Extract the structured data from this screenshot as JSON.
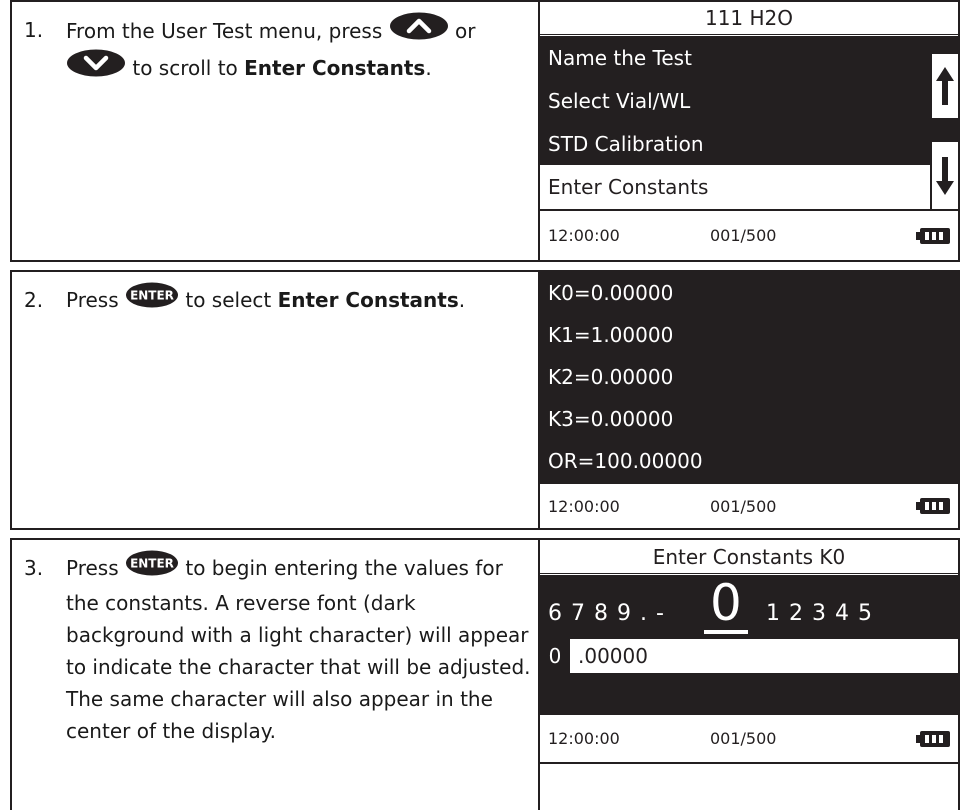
{
  "step1": {
    "number": "1.",
    "text_a": "From the User Test menu, press",
    "text_or": "or",
    "text_b": "to scroll to",
    "bold": "Enter Constants",
    "period": ".",
    "lcd": {
      "title": "111 H2O",
      "items": [
        "Name the Test",
        "Select Vial/WL",
        "STD Calibration",
        "Enter Constants"
      ],
      "selected_index": 3,
      "time": "12:00:00",
      "count": "001/500"
    }
  },
  "step2": {
    "number": "2.",
    "text_a": "Press",
    "text_b": "to select",
    "bold": "Enter Constants",
    "period": ".",
    "lcd": {
      "items": [
        "K0=0.00000",
        "K1=1.00000",
        "K2=0.00000",
        "K3=0.00000",
        "OR=100.00000"
      ],
      "time": "12:00:00",
      "count": "001/500"
    }
  },
  "step3": {
    "number": "3.",
    "text_a": "Press",
    "text_b": "to begin entering the values for the constants. A reverse font (dark background with a light character) will appear to indicate the character that will be adjusted. The same character will also appear in the center of the display.",
    "lcd": {
      "title": "Enter Constants K0",
      "digits_left": "6 7 8 9 . -",
      "digit_center": "0",
      "digits_right": "1 2 3 4 5",
      "value_cursor": "0",
      "value_rest": ".00000",
      "time": "12:00:00",
      "count": "001/500"
    }
  },
  "icons": {
    "up": "up-chevron-button-icon",
    "down": "down-chevron-button-icon",
    "enter": "enter-button-icon",
    "battery": "battery-full-icon",
    "scroll_up": "up-arrow-icon",
    "scroll_down": "down-arrow-icon"
  },
  "colors": {
    "lcd_dark": "#231f20",
    "lcd_light": "#ffffff"
  }
}
